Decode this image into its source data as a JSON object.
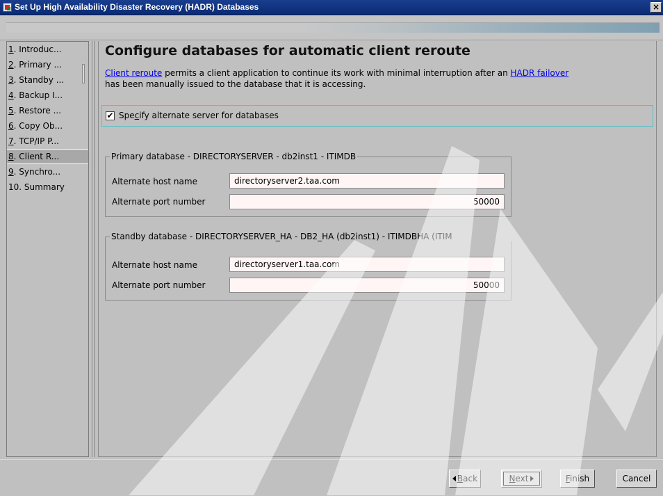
{
  "window": {
    "title": "Set Up High Availability Disaster Recovery (HADR) Databases",
    "close_label": "×"
  },
  "steps": [
    {
      "num": "1",
      "label": ". Introduc..."
    },
    {
      "num": "2",
      "label": ". Primary ..."
    },
    {
      "num": "3",
      "label": ". Standby ..."
    },
    {
      "num": "4",
      "label": ". Backup I..."
    },
    {
      "num": "5",
      "label": ". Restore ..."
    },
    {
      "num": "6",
      "label": ". Copy Ob..."
    },
    {
      "num": "7",
      "label": ". TCP/IP P..."
    },
    {
      "num": "8",
      "label": ". Client R..."
    },
    {
      "num": "9",
      "label": ". Synchro..."
    },
    {
      "num": "",
      "label": "10. Summary"
    }
  ],
  "page": {
    "title": "Configure databases for automatic client reroute",
    "desc_link1": "Client reroute",
    "desc_text1": " permits a client application to continue its work with minimal interruption after an ",
    "desc_link2": "HADR failover",
    "desc_text2": "has been manually issued to the database that it is accessing.",
    "checkbox_checked": true,
    "checkbox_mark": "✔",
    "checkbox_label_a": "Spe",
    "checkbox_label_u": "c",
    "checkbox_label_b": "ify alternate server for databases"
  },
  "primary": {
    "title": "Primary database - DIRECTORYSERVER - db2inst1 - ITIMDB",
    "host_label": "Alternate host name",
    "host_value": "directoryserver2.taa.com",
    "port_label": "Alternate port number",
    "port_value": "50000"
  },
  "standby": {
    "title": "Standby database - DIRECTORYSERVER_HA - DB2_HA (db2inst1)  - ITIMDBHA (ITIM",
    "host_label": "Alternate host name",
    "host_value": "directoryserver1.taa.com",
    "port_label": "Alternate port number",
    "port_value": "50000"
  },
  "buttons": {
    "back_u": "B",
    "back_rest": "ack",
    "next_u": "N",
    "next_rest": "ext",
    "finish_u": "F",
    "finish_rest": "inish",
    "cancel": "Cancel"
  },
  "colors": {
    "titlebar": "#0a2a72",
    "window_bg": "#c0c0c0",
    "link": "#0000ee",
    "input_bg": "#fff5f5",
    "focus_border": "#55c0c8"
  }
}
